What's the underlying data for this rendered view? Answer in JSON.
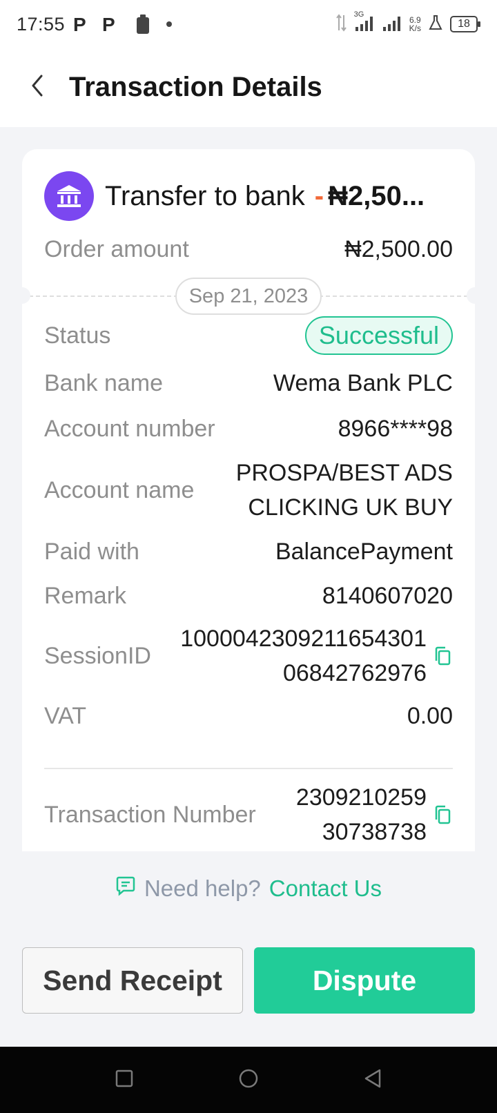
{
  "status_bar": {
    "time": "17:55",
    "notif_icons": [
      "P",
      "P"
    ],
    "network_type": "3G",
    "speed_value": "6.9",
    "speed_unit": "K/s",
    "battery": "18"
  },
  "header": {
    "title": "Transaction Details"
  },
  "card": {
    "title": "Transfer to bank",
    "title_dash": "-",
    "title_amount": "₦2,50...",
    "order_amount_label": "Order amount",
    "order_amount_value": "₦2,500.00",
    "date": "Sep 21, 2023"
  },
  "details": {
    "status_label": "Status",
    "status_value": "Successful",
    "bank_name_label": "Bank name",
    "bank_name_value": "Wema Bank PLC",
    "account_number_label": "Account number",
    "account_number_value": "8966****98",
    "account_name_label": "Account name",
    "account_name_line1": "PROSPA/BEST ADS",
    "account_name_line2": "CLICKING UK BUY",
    "paid_with_label": "Paid with",
    "paid_with_value": "BalancePayment",
    "remark_label": "Remark",
    "remark_value": "8140607020",
    "session_label": "SessionID",
    "session_line1": "1000042309211654301",
    "session_line2": "06842762976",
    "vat_label": "VAT",
    "vat_value": "0.00",
    "txn_label": "Transaction Number",
    "txn_line1": "2309210259",
    "txn_line2": "30738738"
  },
  "help": {
    "question": "Need help?",
    "link": "Contact Us"
  },
  "actions": {
    "send_receipt": "Send Receipt",
    "dispute": "Dispute"
  },
  "colors": {
    "accent_green": "#21cc98",
    "bank_icon_purple": "#7b47f0",
    "minus_orange": "#f26a3a"
  }
}
